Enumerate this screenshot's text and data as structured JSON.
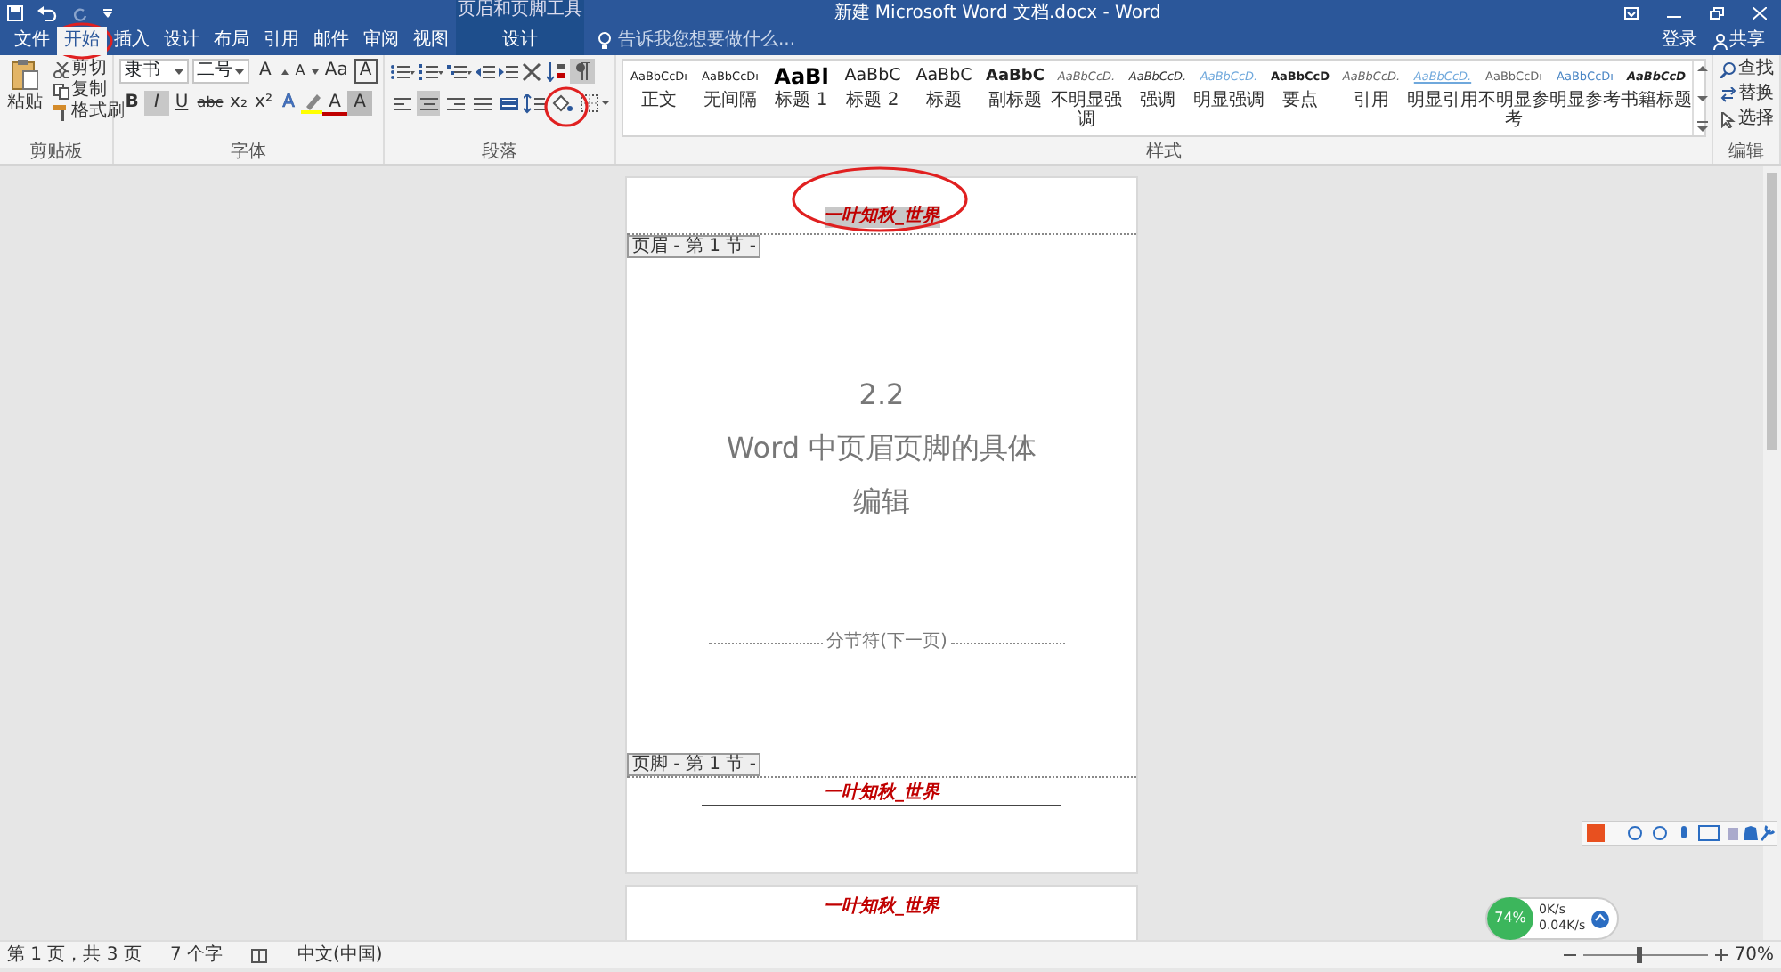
{
  "title_bar": {
    "contextual_group": "页眉和页脚工具",
    "title": "新建 Microsoft Word 文档.docx - Word"
  },
  "tabs": [
    {
      "label": "文件",
      "selected": false,
      "kind": "file"
    },
    {
      "label": "开始",
      "selected": true,
      "kind": "normal"
    },
    {
      "label": "插入",
      "selected": false,
      "kind": "normal"
    },
    {
      "label": "设计",
      "selected": false,
      "kind": "normal"
    },
    {
      "label": "布局",
      "selected": false,
      "kind": "normal"
    },
    {
      "label": "引用",
      "selected": false,
      "kind": "normal"
    },
    {
      "label": "邮件",
      "selected": false,
      "kind": "normal"
    },
    {
      "label": "审阅",
      "selected": false,
      "kind": "normal"
    },
    {
      "label": "视图",
      "selected": false,
      "kind": "normal"
    },
    {
      "label": "设计",
      "selected": false,
      "kind": "contextual"
    }
  ],
  "tell_me": {
    "placeholder": "告诉我您想要做什么..."
  },
  "account": {
    "sign_in": "登录",
    "share": "共享"
  },
  "clipboard": {
    "paste": "粘贴",
    "cut": "剪切",
    "copy": "复制",
    "format_painter": "格式刷",
    "label": "剪贴板"
  },
  "font": {
    "font_name": "隶书",
    "font_size": "二号",
    "grow": "A",
    "shrink": "A",
    "change_case": "Aa",
    "border_char": "A",
    "format_buttons": [
      {
        "text": "B",
        "selected": false
      },
      {
        "text": "I",
        "selected": true
      },
      {
        "text": "U",
        "selected": false
      },
      {
        "text": "abc",
        "selected": false
      },
      {
        "text": "x₂",
        "selected": false
      },
      {
        "text": "x²",
        "selected": false
      }
    ],
    "text_effects": "A",
    "font_color": "A",
    "char_shading": "A",
    "label": "字体"
  },
  "paragraph": {
    "alignment": [
      {
        "selected": false
      },
      {
        "selected": true
      },
      {
        "selected": false
      },
      {
        "selected": false
      },
      {
        "selected": false
      }
    ],
    "show_marks": true,
    "label": "段落"
  },
  "styles": {
    "items": [
      {
        "preview": "AaBbCcDı",
        "name": "正文"
      },
      {
        "preview": "AaBbCcDı",
        "name": "无间隔"
      },
      {
        "preview": "AaBl",
        "name": "标题 1"
      },
      {
        "preview": "AaBbC",
        "name": "标题 2"
      },
      {
        "preview": "AaBbC",
        "name": "标题"
      },
      {
        "preview": "AaBbC",
        "name": "副标题"
      },
      {
        "preview": "AaBbCcD.",
        "name": "不明显强调"
      },
      {
        "preview": "AaBbCcD.",
        "name": "强调"
      },
      {
        "preview": "AaBbCcD.",
        "name": "明显强调"
      },
      {
        "preview": "AaBbCcD",
        "name": "要点"
      },
      {
        "preview": "AaBbCcD.",
        "name": "引用"
      },
      {
        "preview": "AaBbCcD.",
        "name": "明显引用"
      },
      {
        "preview": "AaBbCcDı",
        "name": "不明显参考"
      },
      {
        "preview": "AaBbCcDı",
        "name": "明显参考"
      },
      {
        "preview": "AaBbCcD",
        "name": "书籍标题"
      }
    ],
    "label": "样式"
  },
  "editing": {
    "find": "查找",
    "replace": "替换",
    "select": "选择",
    "label": "编辑"
  },
  "document": {
    "header_tag": "页眉 - 第 1 节 -",
    "header_text": {
      "text": "一叶知秋_世界",
      "selected": true
    },
    "heading_lines": [
      "2.2",
      "Word 中页眉页脚的具体",
      "编辑"
    ],
    "section_break": "分节符(下一页)",
    "footer_tag": "页脚 - 第 1 节 -",
    "footer_text": "一叶知秋_世界",
    "page2_header_text": "一叶知秋_世界"
  },
  "status_bar": {
    "page": "第 1 页，共 3 页",
    "words": "7 个字",
    "language": "中文(中国)",
    "zoom_slider": {
      "level": 0.45
    },
    "zoom": "70%"
  },
  "net_widget": {
    "percent": "74%",
    "upload": "0K/s",
    "download": "0.04K/s"
  }
}
